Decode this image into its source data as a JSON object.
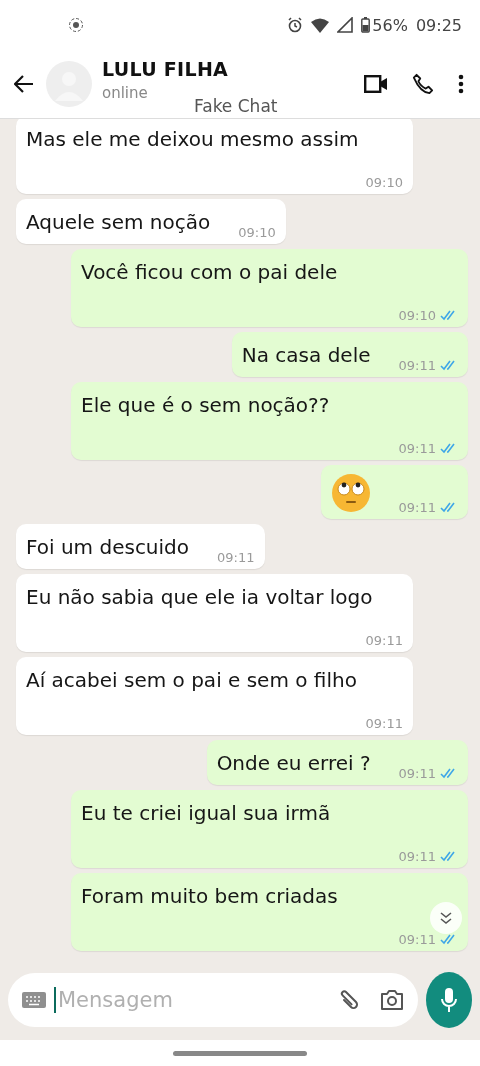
{
  "status_bar": {
    "battery": "56%",
    "time": "09:25"
  },
  "header": {
    "name": "LULU FILHA",
    "status": "online",
    "watermark": "Fake Chat"
  },
  "messages": [
    {
      "kind": "text",
      "outgoing": false,
      "text": "Mas ele me deixou mesmo assim",
      "time": "09:10",
      "time_inline": false
    },
    {
      "kind": "text",
      "outgoing": false,
      "text": "Aquele sem noção",
      "time": "09:10",
      "time_inline": true
    },
    {
      "kind": "text",
      "outgoing": true,
      "text": "Você ficou com o pai dele",
      "time": "09:10",
      "time_inline": false,
      "read": true
    },
    {
      "kind": "text",
      "outgoing": true,
      "text": "Na casa dele",
      "time": "09:11",
      "time_inline": true,
      "read": true
    },
    {
      "kind": "text",
      "outgoing": true,
      "text": "Ele que é o sem noção??",
      "time": "09:11",
      "time_inline": false,
      "read": true
    },
    {
      "kind": "emoji",
      "outgoing": true,
      "time": "09:11",
      "time_inline": true,
      "read": true
    },
    {
      "kind": "text",
      "outgoing": false,
      "text": "Foi um descuido",
      "time": "09:11",
      "time_inline": true
    },
    {
      "kind": "text",
      "outgoing": false,
      "text": "Eu não sabia que ele ia voltar logo",
      "time": "09:11",
      "time_inline": false
    },
    {
      "kind": "text",
      "outgoing": false,
      "text": "Aí acabei sem o pai e sem o filho",
      "time": "09:11",
      "time_inline": false
    },
    {
      "kind": "text",
      "outgoing": true,
      "text": "Onde eu errei ?",
      "time": "09:11",
      "time_inline": true,
      "read": true
    },
    {
      "kind": "text",
      "outgoing": true,
      "text": "Eu te criei igual sua irmã",
      "time": "09:11",
      "time_inline": false,
      "read": true
    },
    {
      "kind": "text",
      "outgoing": true,
      "text": "Foram muito bem criadas",
      "time": "09:11",
      "time_inline": false,
      "read": true
    }
  ],
  "composer": {
    "placeholder": "Mensagem"
  }
}
